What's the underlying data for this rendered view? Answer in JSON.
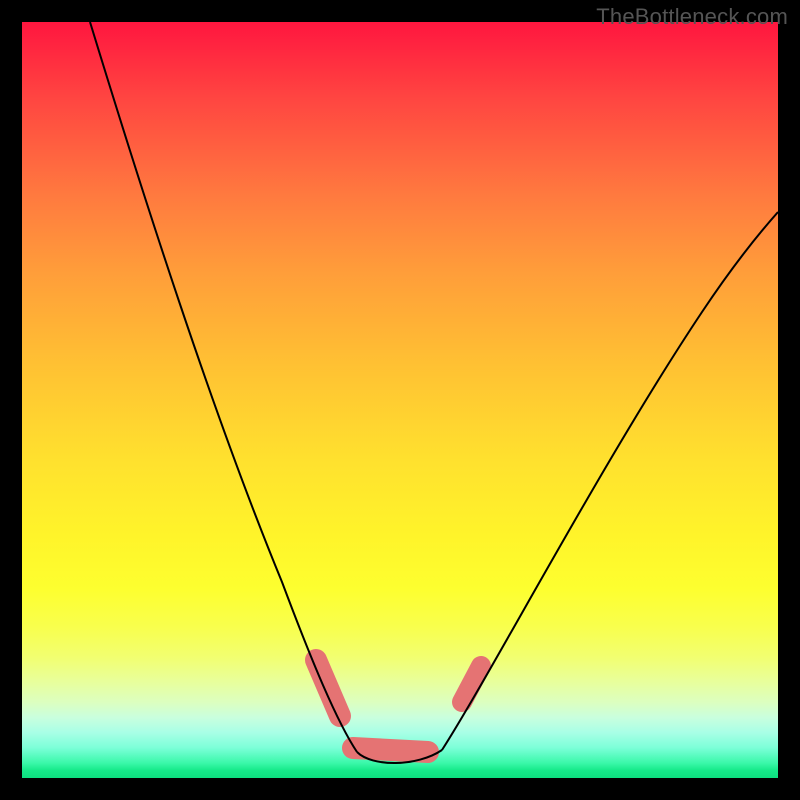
{
  "watermark": "TheBottleneck.com",
  "colors": {
    "sausage": "#e57373",
    "curve": "#000000"
  },
  "chart_data": {
    "type": "line",
    "title": "",
    "xlabel": "",
    "ylabel": "",
    "xlim": [
      0,
      100
    ],
    "ylim": [
      0,
      100
    ],
    "grid": false,
    "series": [
      {
        "name": "left-curve",
        "x": [
          9,
          15,
          20,
          25,
          30,
          35,
          40,
          42,
          44
        ],
        "y": [
          100,
          82,
          67,
          53,
          39,
          26,
          12,
          6,
          2
        ]
      },
      {
        "name": "valley",
        "x": [
          44,
          48,
          52,
          56
        ],
        "y": [
          2,
          0.5,
          0.5,
          2
        ]
      },
      {
        "name": "right-curve",
        "x": [
          56,
          62,
          70,
          78,
          86,
          94,
          100
        ],
        "y": [
          2,
          12,
          27,
          42,
          56,
          68,
          76
        ]
      }
    ],
    "annotations": [
      {
        "name": "highlight-left-descent",
        "x_range": [
          38,
          42
        ],
        "y_range": [
          6,
          16
        ]
      },
      {
        "name": "highlight-trough",
        "x_range": [
          43,
          54
        ],
        "y_range": [
          0,
          3
        ]
      },
      {
        "name": "highlight-right-ascent-gap-below",
        "x_range": [
          55,
          57
        ],
        "y_range": [
          3,
          7
        ]
      },
      {
        "name": "highlight-right-ascent",
        "x_range": [
          57,
          61
        ],
        "y_range": [
          8,
          15
        ]
      }
    ]
  }
}
